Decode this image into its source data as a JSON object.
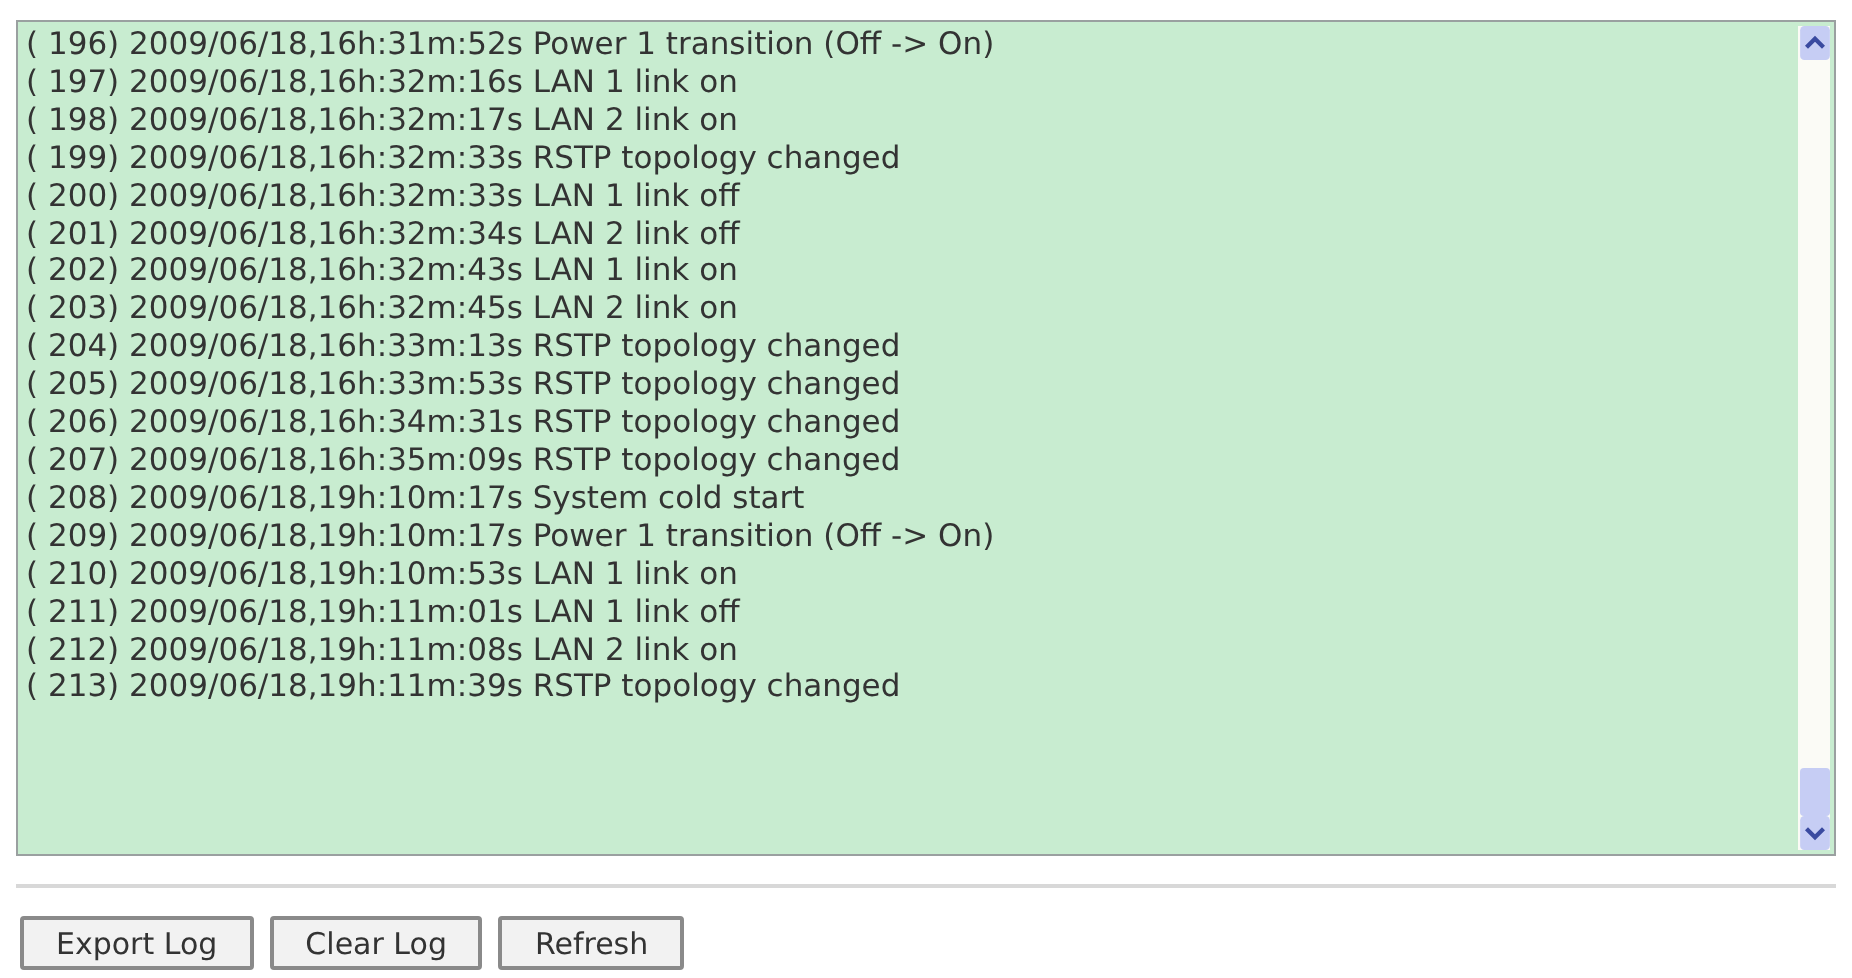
{
  "log_lines": [
    "( 196) 2009/06/18,16h:31m:52s Power 1 transition (Off -> On)",
    "( 197) 2009/06/18,16h:32m:16s LAN 1 link on",
    "( 198) 2009/06/18,16h:32m:17s LAN 2 link on",
    "( 199) 2009/06/18,16h:32m:33s RSTP topology changed",
    "( 200) 2009/06/18,16h:32m:33s LAN 1 link off",
    "( 201) 2009/06/18,16h:32m:34s LAN 2 link off",
    "( 202) 2009/06/18,16h:32m:43s LAN 1 link on",
    "( 203) 2009/06/18,16h:32m:45s LAN 2 link on",
    "( 204) 2009/06/18,16h:33m:13s RSTP topology changed",
    "( 205) 2009/06/18,16h:33m:53s RSTP topology changed",
    "( 206) 2009/06/18,16h:34m:31s RSTP topology changed",
    "( 207) 2009/06/18,16h:35m:09s RSTP topology changed",
    "( 208) 2009/06/18,19h:10m:17s System cold start",
    "( 209) 2009/06/18,19h:10m:17s Power 1 transition (Off -> On)",
    "( 210) 2009/06/18,19h:10m:53s LAN 1 link on",
    "( 211) 2009/06/18,19h:11m:01s LAN 1 link off",
    "( 212) 2009/06/18,19h:11m:08s LAN 2 link on",
    "( 213) 2009/06/18,19h:11m:39s RSTP topology changed"
  ],
  "buttons": [
    "Export Log",
    "Clear Log",
    "Refresh"
  ]
}
